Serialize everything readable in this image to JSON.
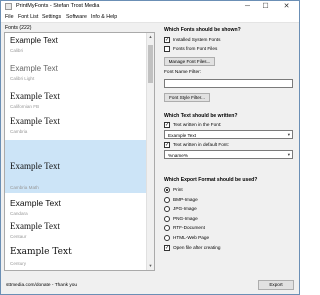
{
  "window": {
    "title": "PrintMyFonts - Stefan Trost Media",
    "minimize": "─",
    "maximize": "☐",
    "close": "✕"
  },
  "menu": [
    "File",
    "Font List",
    "Settings",
    "Software",
    "Info & Help"
  ],
  "font_list": {
    "header": "Fonts (222)",
    "fonts": [
      {
        "sample": "Example Text",
        "name": "Calibri"
      },
      {
        "sample": "Example Text",
        "name": "Calibri Light"
      },
      {
        "sample": "Example Text",
        "name": "Californian FB"
      },
      {
        "sample": "Example Text",
        "name": "Cambria"
      },
      {
        "sample": "Example Text",
        "name": "Cambria Math"
      },
      {
        "sample": "Example Text",
        "name": "Candara"
      },
      {
        "sample": "Example Text",
        "name": "Centaur"
      },
      {
        "sample": "Example Text",
        "name": "Century"
      }
    ]
  },
  "fonts_section": {
    "title": "Which Fonts should be shown?",
    "installed_label": "Installed System Fonts",
    "installed_checked": true,
    "from_files_label": "Fonts from Font Files",
    "from_files_checked": false,
    "manage_button": "Manage Font Files...",
    "filter_label": "Font Name Filter:",
    "filter_value": "",
    "style_button": "Font Style Filter..."
  },
  "text_section": {
    "title": "Which Text should be written?",
    "in_font_label": "Text written in the Font:",
    "in_font_checked": true,
    "in_font_value": "Example Text",
    "default_label": "Text written in default Font:",
    "default_checked": true,
    "default_value": "%name%"
  },
  "export_section": {
    "title": "Which Export Format should be used?",
    "options": [
      "Print",
      "BMP-Image",
      "JPG-Image",
      "PNG-Image",
      "RTF-Document",
      "HTML-Web Page"
    ],
    "selected": "Print",
    "open_label": "Open file after creating",
    "open_checked": true
  },
  "status": {
    "link": "sttmedia.com/donate - Thank you",
    "export_button": "Export"
  }
}
